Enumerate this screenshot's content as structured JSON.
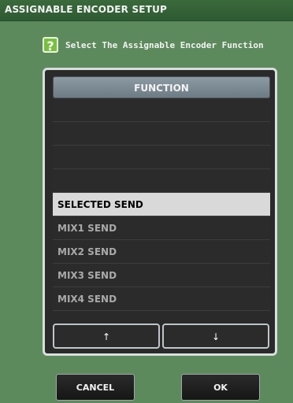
{
  "window": {
    "title": "ASSIGNABLE ENCODER SETUP"
  },
  "prompt": {
    "help_icon": "?",
    "text": "Select The Assignable Encoder Function"
  },
  "list": {
    "header": "FUNCTION",
    "items": [
      "",
      "",
      "",
      "",
      "SELECTED SEND",
      "MIX1 SEND",
      "MIX2 SEND",
      "MIX3 SEND",
      "MIX4 SEND"
    ],
    "selected_label": "SELECTED SEND"
  },
  "buttons": {
    "up": "↑",
    "down": "↓",
    "cancel": "CANCEL",
    "ok": "OK"
  },
  "colors": {
    "background": "#5d8a5c",
    "titlebar": "#2f5a32",
    "panel": "#2a2a2a",
    "selected": "#d9d9d9",
    "help_icon": "#78c03e"
  }
}
